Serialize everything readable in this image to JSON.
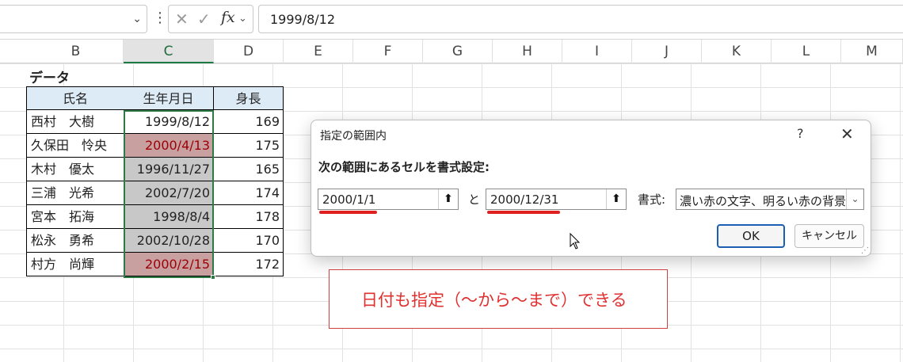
{
  "formula_bar": {
    "name_box": "",
    "cancel_icon": "cancel-icon",
    "enter_icon": "enter-icon",
    "fx": "fx",
    "formula_value": "1999/8/12"
  },
  "columns": [
    "B",
    "C",
    "D",
    "E",
    "F",
    "G",
    "H",
    "I",
    "J",
    "K",
    "L",
    "M"
  ],
  "sheet": {
    "title": "データ",
    "headers": [
      "氏名",
      "生年月日",
      "身長"
    ],
    "rows": [
      {
        "name": "西村　大樹",
        "birth": "1999/8/12",
        "height": "169",
        "fill": "none"
      },
      {
        "name": "久保田　怜央",
        "birth": "2000/4/13",
        "height": "175",
        "fill": "red"
      },
      {
        "name": "木村　優太",
        "birth": "1996/11/27",
        "height": "165",
        "fill": "gray"
      },
      {
        "name": "三浦　光希",
        "birth": "2002/7/20",
        "height": "174",
        "fill": "gray"
      },
      {
        "name": "宮本　拓海",
        "birth": "1998/8/4",
        "height": "178",
        "fill": "gray"
      },
      {
        "name": "松永　勇希",
        "birth": "2002/10/28",
        "height": "170",
        "fill": "gray"
      },
      {
        "name": "村方　尚輝",
        "birth": "2000/2/15",
        "height": "172",
        "fill": "red"
      }
    ]
  },
  "dialog": {
    "title": "指定の範囲内",
    "help": "?",
    "close": "✕",
    "prompt": "次の範囲にあるセルを書式設定:",
    "from_value": "2000/1/1",
    "and_label": "と",
    "to_value": "2000/12/31",
    "format_label": "書式:",
    "format_value": "濃い赤の文字、明るい赤の背景",
    "ok": "OK",
    "cancel": "キャンセル"
  },
  "annotation": {
    "text": "日付も指定（～から～まで）できる"
  },
  "colors": {
    "accent_green": "#1e7a45",
    "red_fill": "#c9a0a0",
    "red_text": "#9c0006",
    "header_blue": "#ddebf7",
    "underline_red": "#e02020"
  }
}
